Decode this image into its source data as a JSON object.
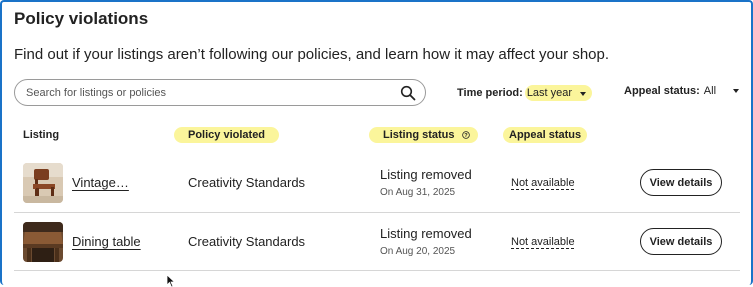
{
  "page": {
    "title": "Policy violations",
    "description": "Find out if your listings aren’t following our policies, and learn how it may affect your shop."
  },
  "search": {
    "placeholder": "Search for listings or policies",
    "icon": "search-icon"
  },
  "filters": {
    "time_period_label": "Time period:",
    "time_period_value": "Last year",
    "appeal_status_label": "Appeal status:",
    "appeal_status_value": "All"
  },
  "table": {
    "headers": {
      "listing": "Listing",
      "policy": "Policy violated",
      "status": "Listing status",
      "appeal": "Appeal status"
    },
    "rows": [
      {
        "name": "Vintage…",
        "policy": "Creativity Standards",
        "status": "Listing removed",
        "date": "On Aug 31, 2025",
        "appeal": "Not available",
        "action": "View details"
      },
      {
        "name": "Dining table",
        "policy": "Creativity Standards",
        "status": "Listing removed",
        "date": "On Aug 20, 2025",
        "appeal": "Not available",
        "action": "View details"
      }
    ]
  },
  "colors": {
    "highlight": "#fbf59b",
    "frame": "#1a73c8",
    "text": "#222222"
  }
}
